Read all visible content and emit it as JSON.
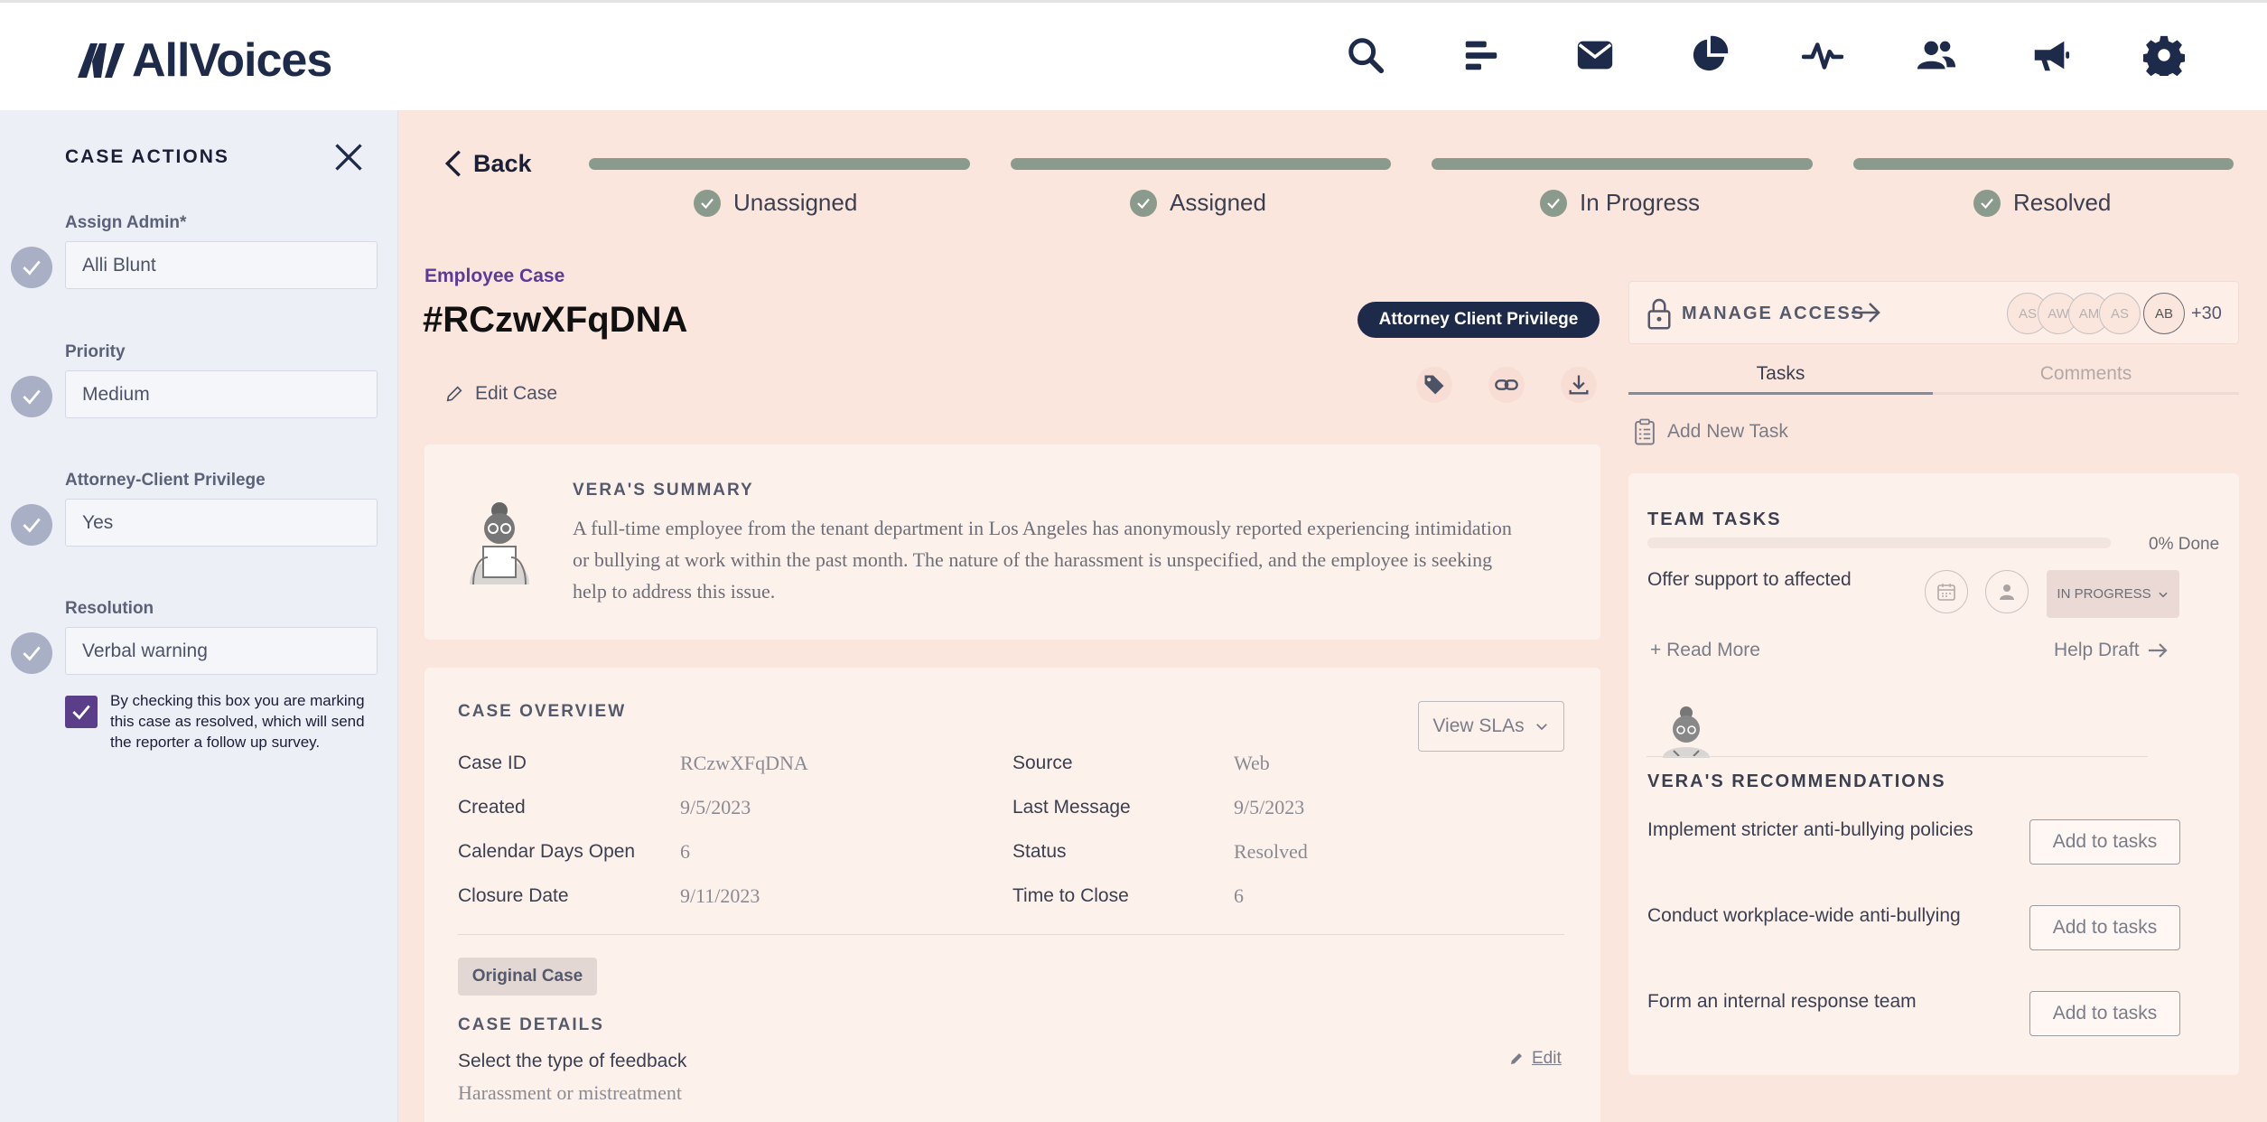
{
  "header": {
    "brand": "AllVoices",
    "nav_icons": [
      "search-icon",
      "bar-list-icon",
      "mail-icon",
      "pie-chart-icon",
      "pulse-icon",
      "users-icon",
      "megaphone-icon",
      "gear-icon"
    ]
  },
  "sidebar": {
    "title": "CASE ACTIONS",
    "fields": [
      {
        "label": "Assign Admin*",
        "value": "Alli Blunt"
      },
      {
        "label": "Priority",
        "value": "Medium"
      },
      {
        "label": "Attorney-Client Privilege",
        "value": "Yes"
      },
      {
        "label": "Resolution",
        "value": "Verbal warning"
      }
    ],
    "resolve_note": "By checking this box you are marking this case as resolved, which will send the reporter a follow up survey.",
    "resolve_checked": true
  },
  "back_label": "Back",
  "steps": [
    "Unassigned",
    "Assigned",
    "In Progress",
    "Resolved"
  ],
  "case": {
    "type": "Employee Case",
    "id": "#RCzwXFqDNA",
    "badge": "Attorney Client Privilege",
    "edit_label": "Edit Case"
  },
  "summary": {
    "title": "VERA'S SUMMARY",
    "text": "A full-time employee from the tenant department in Los Angeles has anonymously reported experiencing intimidation or bullying at work within the past month. The nature of the harassment is unspecified, and the employee is seeking help to address this issue."
  },
  "overview": {
    "title": "CASE OVERVIEW",
    "sla_label": "View SLAs",
    "left": [
      {
        "k": "Case ID",
        "v": "RCzwXFqDNA"
      },
      {
        "k": "Created",
        "v": "9/5/2023"
      },
      {
        "k": "Calendar Days Open",
        "v": "6"
      },
      {
        "k": "Closure Date",
        "v": "9/11/2023"
      }
    ],
    "right": [
      {
        "k": "Source",
        "v": "Web"
      },
      {
        "k": "Last Message",
        "v": "9/5/2023"
      },
      {
        "k": "Status",
        "v": "Resolved"
      },
      {
        "k": "Time to Close",
        "v": "6"
      }
    ],
    "original_tab": "Original Case",
    "details_title": "CASE DETAILS",
    "detail_label": "Select the type of feedback",
    "detail_value": "Harassment or mistreatment",
    "detail_edit": "Edit"
  },
  "access": {
    "label": "MANAGE ACCESS",
    "avatars": [
      "AS",
      "AW",
      "AM",
      "AS",
      "AB"
    ],
    "more": "+30"
  },
  "tabs": {
    "tasks": "Tasks",
    "comments": "Comments"
  },
  "add_task": "Add New Task",
  "team_tasks": {
    "title": "TEAM TASKS",
    "progress_label": "0% Done",
    "progress": 0,
    "task": "Offer support to affected",
    "status": "IN PROGRESS",
    "read_more": "+ Read More",
    "help_draft": "Help Draft"
  },
  "recommendations": {
    "title": "VERA'S RECOMMENDATIONS",
    "items": [
      "Implement stricter anti-bullying policies",
      "Conduct workplace-wide anti-bullying",
      "Form an internal response team"
    ],
    "add_label": "Add to tasks"
  }
}
